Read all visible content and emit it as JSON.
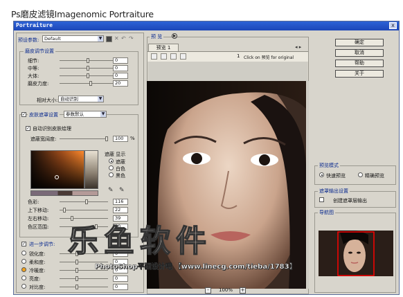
{
  "caption": "Ps磨皮滤镜Imagenomic Portraiture",
  "window": {
    "title": "Portraiture",
    "close_glyph": "x"
  },
  "left": {
    "preset_label": "预设参数:",
    "preset_value": "Default",
    "detail_group": "磨皮调节设置",
    "detail_rows": [
      {
        "label": "细节:",
        "value": "0"
      },
      {
        "label": "中等:",
        "value": "0"
      },
      {
        "label": "大体:",
        "value": "0"
      },
      {
        "label": "磨皮力度:",
        "value": "20"
      }
    ],
    "threshold_label": "相对大小:",
    "threshold_value": "自动识别",
    "mask_group": "皮肤遮罩设置",
    "mask_preset": "参数默认",
    "auto_mask_label": "自动识别皮肤绘理",
    "latitude_label": "遮蔽宽阔度:",
    "latitude_value": "100",
    "latitude_unit": "%",
    "mask_preview_label": "遮蔽 显示",
    "mask_preview_options": [
      "遮蔽",
      "白色",
      "黑色"
    ],
    "color_rows": [
      {
        "label": "色彩:",
        "value": "116"
      },
      {
        "label": "上下移动:",
        "value": "22"
      },
      {
        "label": "左右移动:",
        "value": "39"
      },
      {
        "label": "色区范围:",
        "value": "80"
      }
    ],
    "enhance_label": "进一步调节:",
    "enhance_rows": [
      {
        "label": "锐化度:",
        "value": "0"
      },
      {
        "label": "柔和度:",
        "value": "0"
      },
      {
        "label": "冷暖度:",
        "value": "0"
      },
      {
        "label": "亮度:",
        "value": "0"
      },
      {
        "label": "对比度:",
        "value": "0"
      }
    ]
  },
  "preview": {
    "group_label": "预 览",
    "tab_label": "预览 1",
    "hint": "Click on 预览 for original",
    "zoom": "100%"
  },
  "right": {
    "buttons": [
      "确定",
      "取消",
      "帮助",
      "关于"
    ],
    "mode_group": "预览模式",
    "mode_options": [
      "快速预览",
      "精确预览"
    ],
    "output_group": "遮罩输出设置",
    "output_label": "创建遮罩层输出",
    "nav_group": "导航图"
  },
  "watermark": {
    "big": "乐鱼软件",
    "small": "PhotoShop平面设计吧 【www.linecg.com/tieba/1783】"
  },
  "colors": {
    "titlebar": "#1d47b8",
    "group_label": "#0b2b8f",
    "nav_frame": "#ff0000"
  }
}
